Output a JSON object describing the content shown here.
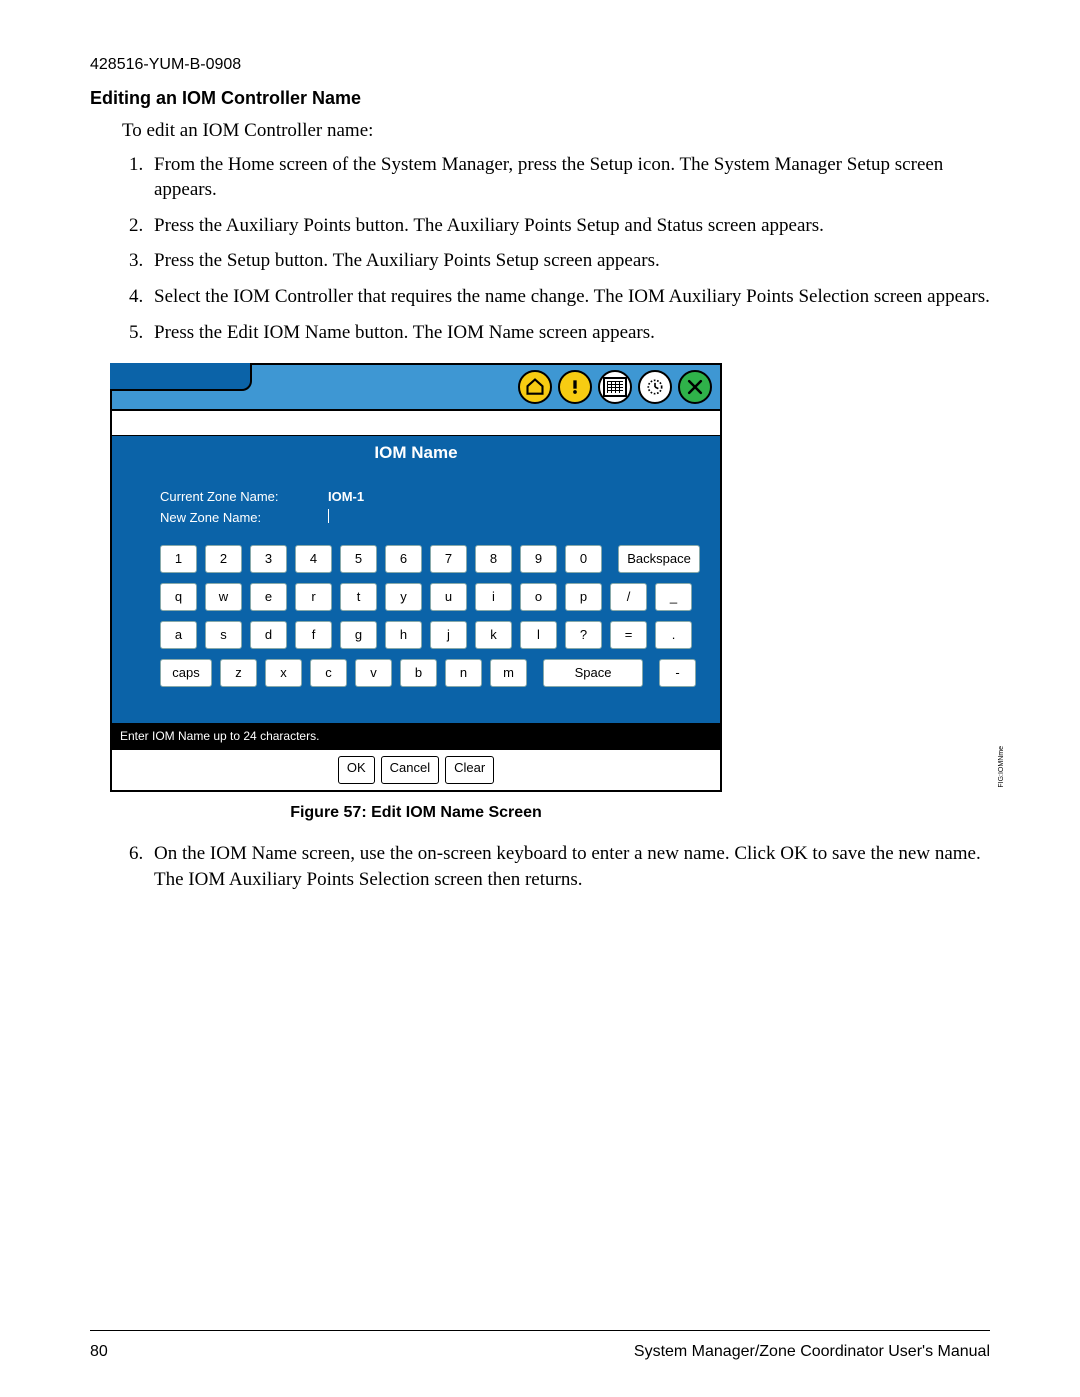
{
  "header": {
    "doc_id": "428516-YUM-B-0908"
  },
  "section": {
    "title": "Editing an IOM Controller Name",
    "intro": "To edit an IOM Controller name:",
    "steps": [
      "From the Home screen of the System Manager, press the Setup icon. The System Manager Setup screen appears.",
      "Press the Auxiliary Points button. The Auxiliary Points Setup and Status screen appears.",
      "Press the Setup button. The Auxiliary Points Setup screen appears.",
      "Select the IOM Controller that requires the name change. The IOM Auxiliary Points Selection screen appears.",
      "Press the Edit IOM Name button. The IOM Name screen appears."
    ],
    "steps_after": [
      "On the IOM Name screen, use the on-screen keyboard to enter a new name. Click OK to save the new name. The IOM Auxiliary Points Selection screen then returns."
    ]
  },
  "figure": {
    "caption": "Figure 57: Edit IOM Name Screen",
    "side_label": "FIG:IOMNme",
    "title": "IOM Name",
    "current_label": "Current Zone Name:",
    "current_value": "IOM-1",
    "new_label": "New Zone Name:",
    "hint": "Enter IOM Name up to 24 characters.",
    "buttons": {
      "ok": "OK",
      "cancel": "Cancel",
      "clear": "Clear"
    },
    "toolbar_icons": [
      "home-icon",
      "alert-icon",
      "calendar-icon",
      "clock-icon",
      "close-icon"
    ],
    "keyboard": {
      "row1": [
        "1",
        "2",
        "3",
        "4",
        "5",
        "6",
        "7",
        "8",
        "9",
        "0"
      ],
      "row1_extra": "Backspace",
      "row2": [
        "q",
        "w",
        "e",
        "r",
        "t",
        "y",
        "u",
        "i",
        "o",
        "p",
        "/",
        "_"
      ],
      "row3": [
        "a",
        "s",
        "d",
        "f",
        "g",
        "h",
        "j",
        "k",
        "l",
        "?",
        "=",
        "."
      ],
      "row4_caps": "caps",
      "row4": [
        "z",
        "x",
        "c",
        "v",
        "b",
        "n",
        "m"
      ],
      "row4_space": "Space",
      "row4_dash": "-"
    }
  },
  "footer": {
    "page": "80",
    "manual_title": "System Manager/Zone Coordinator User's Manual"
  }
}
